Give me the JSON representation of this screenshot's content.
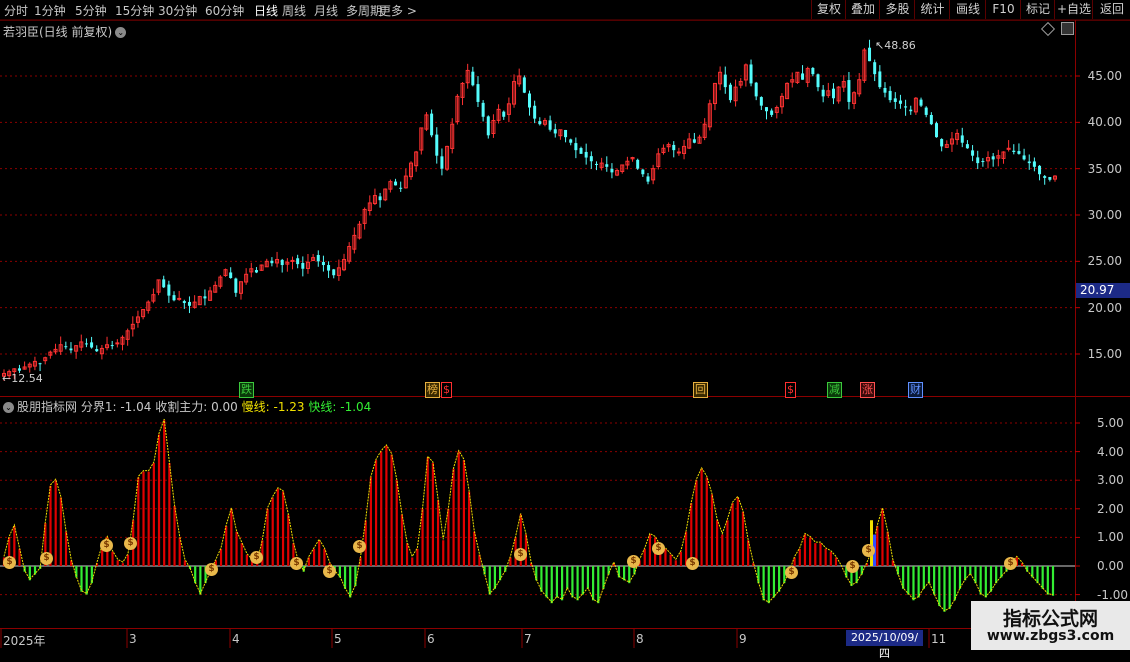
{
  "toolbar": {
    "periods": [
      "分时",
      "1分钟",
      "5分钟",
      "15分钟",
      "30分钟",
      "60分钟",
      "日线",
      "周线",
      "月线",
      "多周期",
      "更多 >"
    ],
    "active_period": "日线",
    "buttons": [
      "复权",
      "叠加",
      "多股",
      "统计",
      "画线",
      "F10",
      "标记",
      "+自选",
      "返回"
    ]
  },
  "main": {
    "title": "若羽臣(日线 前复权)",
    "high_label": "48.86",
    "low_label": "12.54",
    "last_price": "20.97",
    "price_ticks": [
      "45.00",
      "40.00",
      "35.00",
      "30.00",
      "25.00",
      "20.00",
      "15.00"
    ],
    "markers": [
      {
        "text": "跌",
        "color": "#3cc83c",
        "bg": "#0a3a0a"
      },
      {
        "text": "榜",
        "color": "#e8b040",
        "bg": "#3a2a00"
      },
      {
        "text": "$",
        "color": "#ff3030",
        "bg": "#000"
      },
      {
        "text": "回",
        "color": "#e8b040",
        "bg": "#3a2a00"
      },
      {
        "text": "$",
        "color": "#ff3030",
        "bg": "#000"
      },
      {
        "text": "减",
        "color": "#3cc83c",
        "bg": "#0a3a0a"
      },
      {
        "text": "涨",
        "color": "#ff5050",
        "bg": "#3a0a0a"
      },
      {
        "text": "财",
        "color": "#6090ff",
        "bg": "#0a1a3a"
      }
    ]
  },
  "indicator": {
    "name": "股朋指标网",
    "fenjie": "分界1: -1.04",
    "shouge": "收割主力: 0.00",
    "manxian": "慢线: -1.23",
    "kuaixian": "快线: -1.04",
    "ticks": [
      "5.00",
      "4.00",
      "3.00",
      "2.00",
      "1.00",
      "0.00",
      "-1.00"
    ]
  },
  "x_axis": {
    "months": [
      "2025年",
      "3",
      "4",
      "5",
      "6",
      "7",
      "8",
      "9",
      "11"
    ],
    "cursor_date": "2025/10/09/四"
  },
  "watermark": {
    "line1": "指标公式网",
    "line2": "www.zbgs3.com"
  },
  "colors": {
    "up": "#ff3232",
    "down": "#54fcfc",
    "grid": "#8b0000",
    "osc_up": "#e00000",
    "osc_down": "#33ee33",
    "curve": "#f0e000"
  },
  "chart_data": [
    {
      "type": "candlestick",
      "title": "若羽臣(日线 前复权)",
      "ylim": [
        11,
        50
      ],
      "x_start": "2025-01",
      "max_label": 48.86,
      "min_label": 12.54,
      "last_price": 20.97,
      "close": [
        12.9,
        13.1,
        13.4,
        13.2,
        13.6,
        13.9,
        14.2,
        14.0,
        14.6,
        15.2,
        15.5,
        16.0,
        15.8,
        15.4,
        15.9,
        16.3,
        16.1,
        15.7,
        15.3,
        15.6,
        16.0,
        15.9,
        16.2,
        16.8,
        17.5,
        18.2,
        19.0,
        19.8,
        20.6,
        21.4,
        23.0,
        22.2,
        21.3,
        20.8,
        21.0,
        20.5,
        20.2,
        20.6,
        21.2,
        21.0,
        21.8,
        22.4,
        23.3,
        24.1,
        23.2,
        21.6,
        22.8,
        23.6,
        24.2,
        23.8,
        24.6,
        25.0,
        24.8,
        25.2,
        24.6,
        24.9,
        25.1,
        24.7,
        24.2,
        24.9,
        25.4,
        25.0,
        24.6,
        24.0,
        23.5,
        24.3,
        25.2,
        26.6,
        27.8,
        29.0,
        30.6,
        31.3,
        32.1,
        31.6,
        32.8,
        33.6,
        33.2,
        32.9,
        34.2,
        35.6,
        36.8,
        39.4,
        40.8,
        38.6,
        36.4,
        35.0,
        37.4,
        39.8,
        42.8,
        44.2,
        45.6,
        44.0,
        42.2,
        40.6,
        38.6,
        40.2,
        41.4,
        40.6,
        42.0,
        44.4,
        45.0,
        43.2,
        41.6,
        40.4,
        39.8,
        40.2,
        39.2,
        38.8,
        39.2,
        38.4,
        37.8,
        37.0,
        36.6,
        36.2,
        35.8,
        35.4,
        35.6,
        35.2,
        34.6,
        34.8,
        35.4,
        35.8,
        36.2,
        35.0,
        34.4,
        33.6,
        35.0,
        36.6,
        37.2,
        37.6,
        37.0,
        36.8,
        37.4,
        38.2,
        37.8,
        38.4,
        39.8,
        42.0,
        44.2,
        45.4,
        43.8,
        42.4,
        43.8,
        44.4,
        46.2,
        44.2,
        42.8,
        41.8,
        41.2,
        40.8,
        41.6,
        42.8,
        44.2,
        44.6,
        45.4,
        44.6,
        45.8,
        45.2,
        43.8,
        42.8,
        43.4,
        42.6,
        43.8,
        44.4,
        42.2,
        43.2,
        44.6,
        47.8,
        46.6,
        45.2,
        43.8,
        43.2,
        42.4,
        42.2,
        42.0,
        41.6,
        41.2,
        42.6,
        41.8,
        40.8,
        39.8,
        38.4,
        37.4,
        37.6,
        38.2,
        38.8,
        37.8,
        37.2,
        36.4,
        35.6,
        35.8,
        36.2,
        36.0,
        36.4,
        36.8,
        37.2,
        36.8,
        36.6,
        36.0,
        35.6,
        35.2,
        34.4,
        34.0,
        33.8,
        34.2
      ],
      "value_unit": "price (CNY)"
    },
    {
      "type": "bar",
      "title": "股朋指标网",
      "ylim": [
        -1.3,
        5.4
      ],
      "series": [
        {
          "name": "分界1",
          "value": -1.04
        },
        {
          "name": "收割主力",
          "value": 0.0
        },
        {
          "name": "慢线",
          "value": -1.23
        },
        {
          "name": "快线",
          "value": -1.04
        }
      ],
      "values": [
        0.3,
        1.0,
        1.4,
        0.6,
        -0.2,
        -0.5,
        -0.3,
        -0.1,
        1.5,
        2.8,
        3.0,
        2.4,
        1.2,
        0.2,
        -0.4,
        -0.9,
        -1.0,
        -0.6,
        0.1,
        0.7,
        1.0,
        0.5,
        0.2,
        0.1,
        0.4,
        1.6,
        3.1,
        3.3,
        3.3,
        3.6,
        4.6,
        5.1,
        3.6,
        2.1,
        1.0,
        0.2,
        -0.1,
        -0.6,
        -1.0,
        -0.6,
        -0.2,
        0.2,
        0.6,
        1.4,
        2.0,
        1.2,
        0.8,
        0.4,
        0.2,
        0.1,
        0.9,
        2.0,
        2.4,
        2.7,
        2.6,
        1.8,
        0.8,
        0.1,
        -0.2,
        0.3,
        0.6,
        0.9,
        0.6,
        0.1,
        -0.2,
        -0.4,
        -0.8,
        -1.1,
        -0.7,
        0.3,
        1.6,
        3.1,
        3.7,
        4.0,
        4.2,
        3.9,
        3.0,
        1.8,
        0.8,
        0.3,
        0.6,
        2.0,
        3.8,
        3.6,
        2.3,
        0.9,
        2.0,
        3.4,
        4.0,
        3.7,
        2.6,
        1.2,
        0.4,
        -0.3,
        -1.0,
        -0.8,
        -0.5,
        -0.2,
        0.3,
        1.0,
        1.8,
        1.1,
        0.1,
        -0.5,
        -0.9,
        -1.1,
        -1.3,
        -1.1,
        -1.2,
        -0.8,
        -1.1,
        -1.2,
        -1.0,
        -0.8,
        -1.2,
        -1.3,
        -0.8,
        -0.3,
        0.1,
        -0.4,
        -0.5,
        -0.6,
        -0.3,
        0.2,
        0.6,
        1.1,
        1.0,
        0.7,
        0.6,
        0.4,
        0.2,
        0.5,
        1.2,
        2.2,
        3.0,
        3.4,
        3.1,
        2.5,
        1.6,
        1.1,
        1.6,
        2.2,
        2.4,
        1.9,
        0.9,
        0.1,
        -0.6,
        -1.2,
        -1.3,
        -1.1,
        -0.9,
        -0.6,
        -0.2,
        0.3,
        0.6,
        1.1,
        1.0,
        0.8,
        0.8,
        0.6,
        0.5,
        0.3,
        0.0,
        -0.4,
        -0.7,
        -0.6,
        -0.3,
        0.1,
        0.5,
        1.4,
        2.0,
        1.2,
        0.2,
        -0.3,
        -0.8,
        -1.0,
        -1.2,
        -1.1,
        -0.8,
        -0.6,
        -1.0,
        -1.4,
        -1.6,
        -1.5,
        -1.2,
        -0.8,
        -0.5,
        -0.3,
        -0.6,
        -1.0,
        -1.1,
        -0.9,
        -0.6,
        -0.4,
        -0.2,
        0.1,
        0.3,
        0.1,
        -0.2,
        -0.4,
        -0.6,
        -0.8,
        -1.0,
        -1.04
      ]
    }
  ]
}
